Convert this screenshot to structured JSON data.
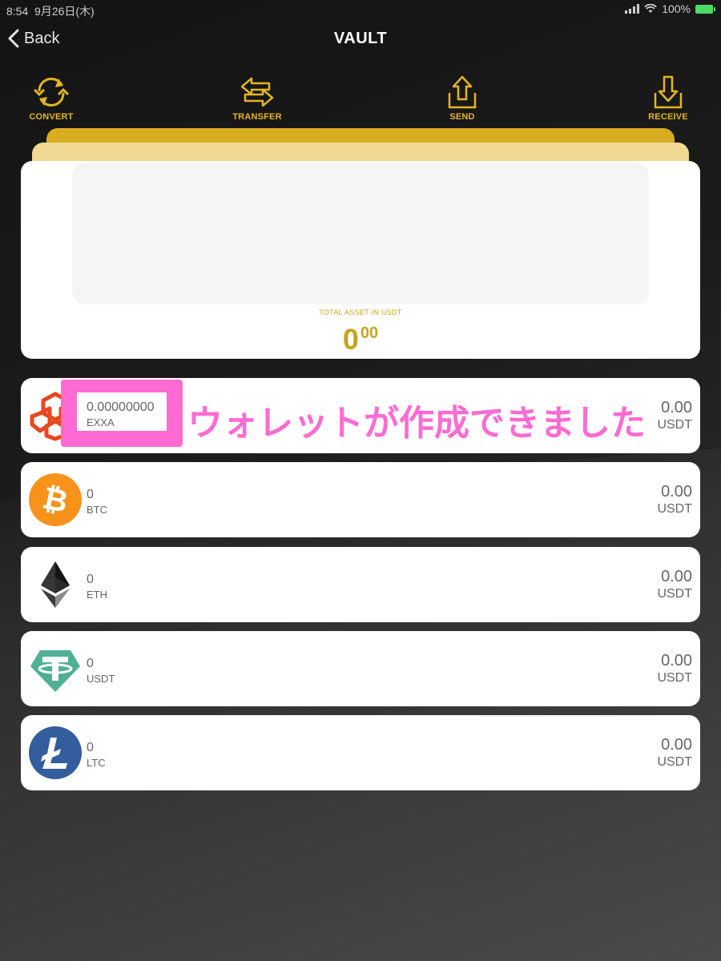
{
  "status_bar": {
    "time": "8:54",
    "date": "9月26日(木)",
    "battery": "100%"
  },
  "header": {
    "back_label": "Back",
    "title": "VAULT"
  },
  "actions": [
    {
      "label": "CONVERT",
      "icon": "convert-icon"
    },
    {
      "label": "TRANSFER",
      "icon": "transfer-icon"
    },
    {
      "label": "SEND",
      "icon": "send-icon"
    },
    {
      "label": "RECEIVE",
      "icon": "receive-icon"
    }
  ],
  "summary": {
    "total_label": "TOTAL ASSET IN USDT",
    "total_int": "0",
    "total_dec": "00"
  },
  "assets": [
    {
      "symbol": "EXXA",
      "amount": "0.00000000",
      "value": "0.00",
      "unit": "USDT",
      "icon": "exxa-logo-icon"
    },
    {
      "symbol": "BTC",
      "amount": "0",
      "value": "0.00",
      "unit": "USDT",
      "icon": "bitcoin-icon"
    },
    {
      "symbol": "ETH",
      "amount": "0",
      "value": "0.00",
      "unit": "USDT",
      "icon": "ethereum-icon"
    },
    {
      "symbol": "USDT",
      "amount": "0",
      "value": "0.00",
      "unit": "USDT",
      "icon": "tether-icon"
    },
    {
      "symbol": "LTC",
      "amount": "0",
      "value": "0.00",
      "unit": "USDT",
      "icon": "litecoin-icon"
    }
  ],
  "annotation": {
    "text": "ウォレットが作成できました"
  },
  "colors": {
    "gold": "#d9ad22",
    "annotation_pink": "#ff6bd2"
  }
}
